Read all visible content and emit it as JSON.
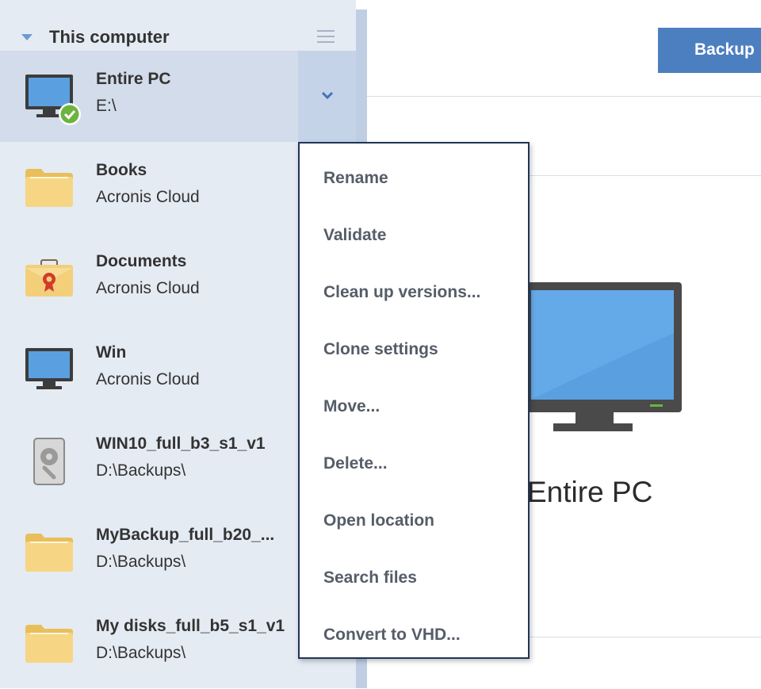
{
  "sidebar": {
    "group_title": "This computer",
    "items": [
      {
        "name": "Entire PC",
        "location": "E:\\",
        "icon": "monitor-check-icon"
      },
      {
        "name": "Books",
        "location": "Acronis Cloud",
        "icon": "folder-icon"
      },
      {
        "name": "Documents",
        "location": "Acronis Cloud",
        "icon": "briefcase-icon"
      },
      {
        "name": "Win",
        "location": "Acronis Cloud",
        "icon": "monitor-icon"
      },
      {
        "name": "WIN10_full_b3_s1_v1",
        "location": "D:\\Backups\\",
        "icon": "hard-drive-icon"
      },
      {
        "name": "MyBackup_full_b20_...",
        "location": "D:\\Backups\\",
        "icon": "folder-icon"
      },
      {
        "name": "My disks_full_b5_s1_v1",
        "location": "D:\\Backups\\",
        "icon": "folder-icon"
      }
    ]
  },
  "main": {
    "backup_button": "Backup",
    "selected_title": "Entire PC"
  },
  "context_menu": {
    "items": [
      "Rename",
      "Validate",
      "Clean up versions...",
      "Clone settings",
      "Move...",
      "Delete...",
      "Open location",
      "Search files",
      "Convert to VHD..."
    ]
  },
  "colors": {
    "accent": "#4c7fc0",
    "sidebar_bg": "#e5ebf3",
    "selected_bg": "#d3dceb",
    "check_green": "#6db33f",
    "folder": "#f3d27a"
  }
}
